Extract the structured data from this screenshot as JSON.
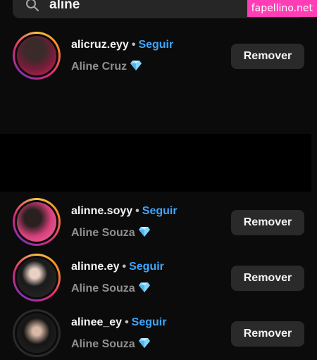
{
  "search": {
    "query": "aline"
  },
  "watermark": "fapellino.net",
  "accounts": [
    {
      "username": "alicruz.eyy",
      "follow_label": "Seguir",
      "full_name": "Aline Cruz",
      "remove_label": "Remover"
    },
    {
      "username": "alinne.soyy",
      "follow_label": "Seguir",
      "full_name": "Aline Souza",
      "remove_label": "Remover"
    },
    {
      "username": "alinne.ey",
      "follow_label": "Seguir",
      "full_name": "Aline Souza",
      "remove_label": "Remover"
    },
    {
      "username": "alinee_ey",
      "follow_label": "Seguir",
      "full_name": "Aline Souza",
      "remove_label": "Remover"
    }
  ],
  "icons": {
    "search": "search-icon",
    "badge": "diamond-icon"
  },
  "colors": {
    "follow_link": "#3ea6ff",
    "watermark_bg": "#ff3eb5",
    "remove_button_bg": "#2a2a2a"
  }
}
